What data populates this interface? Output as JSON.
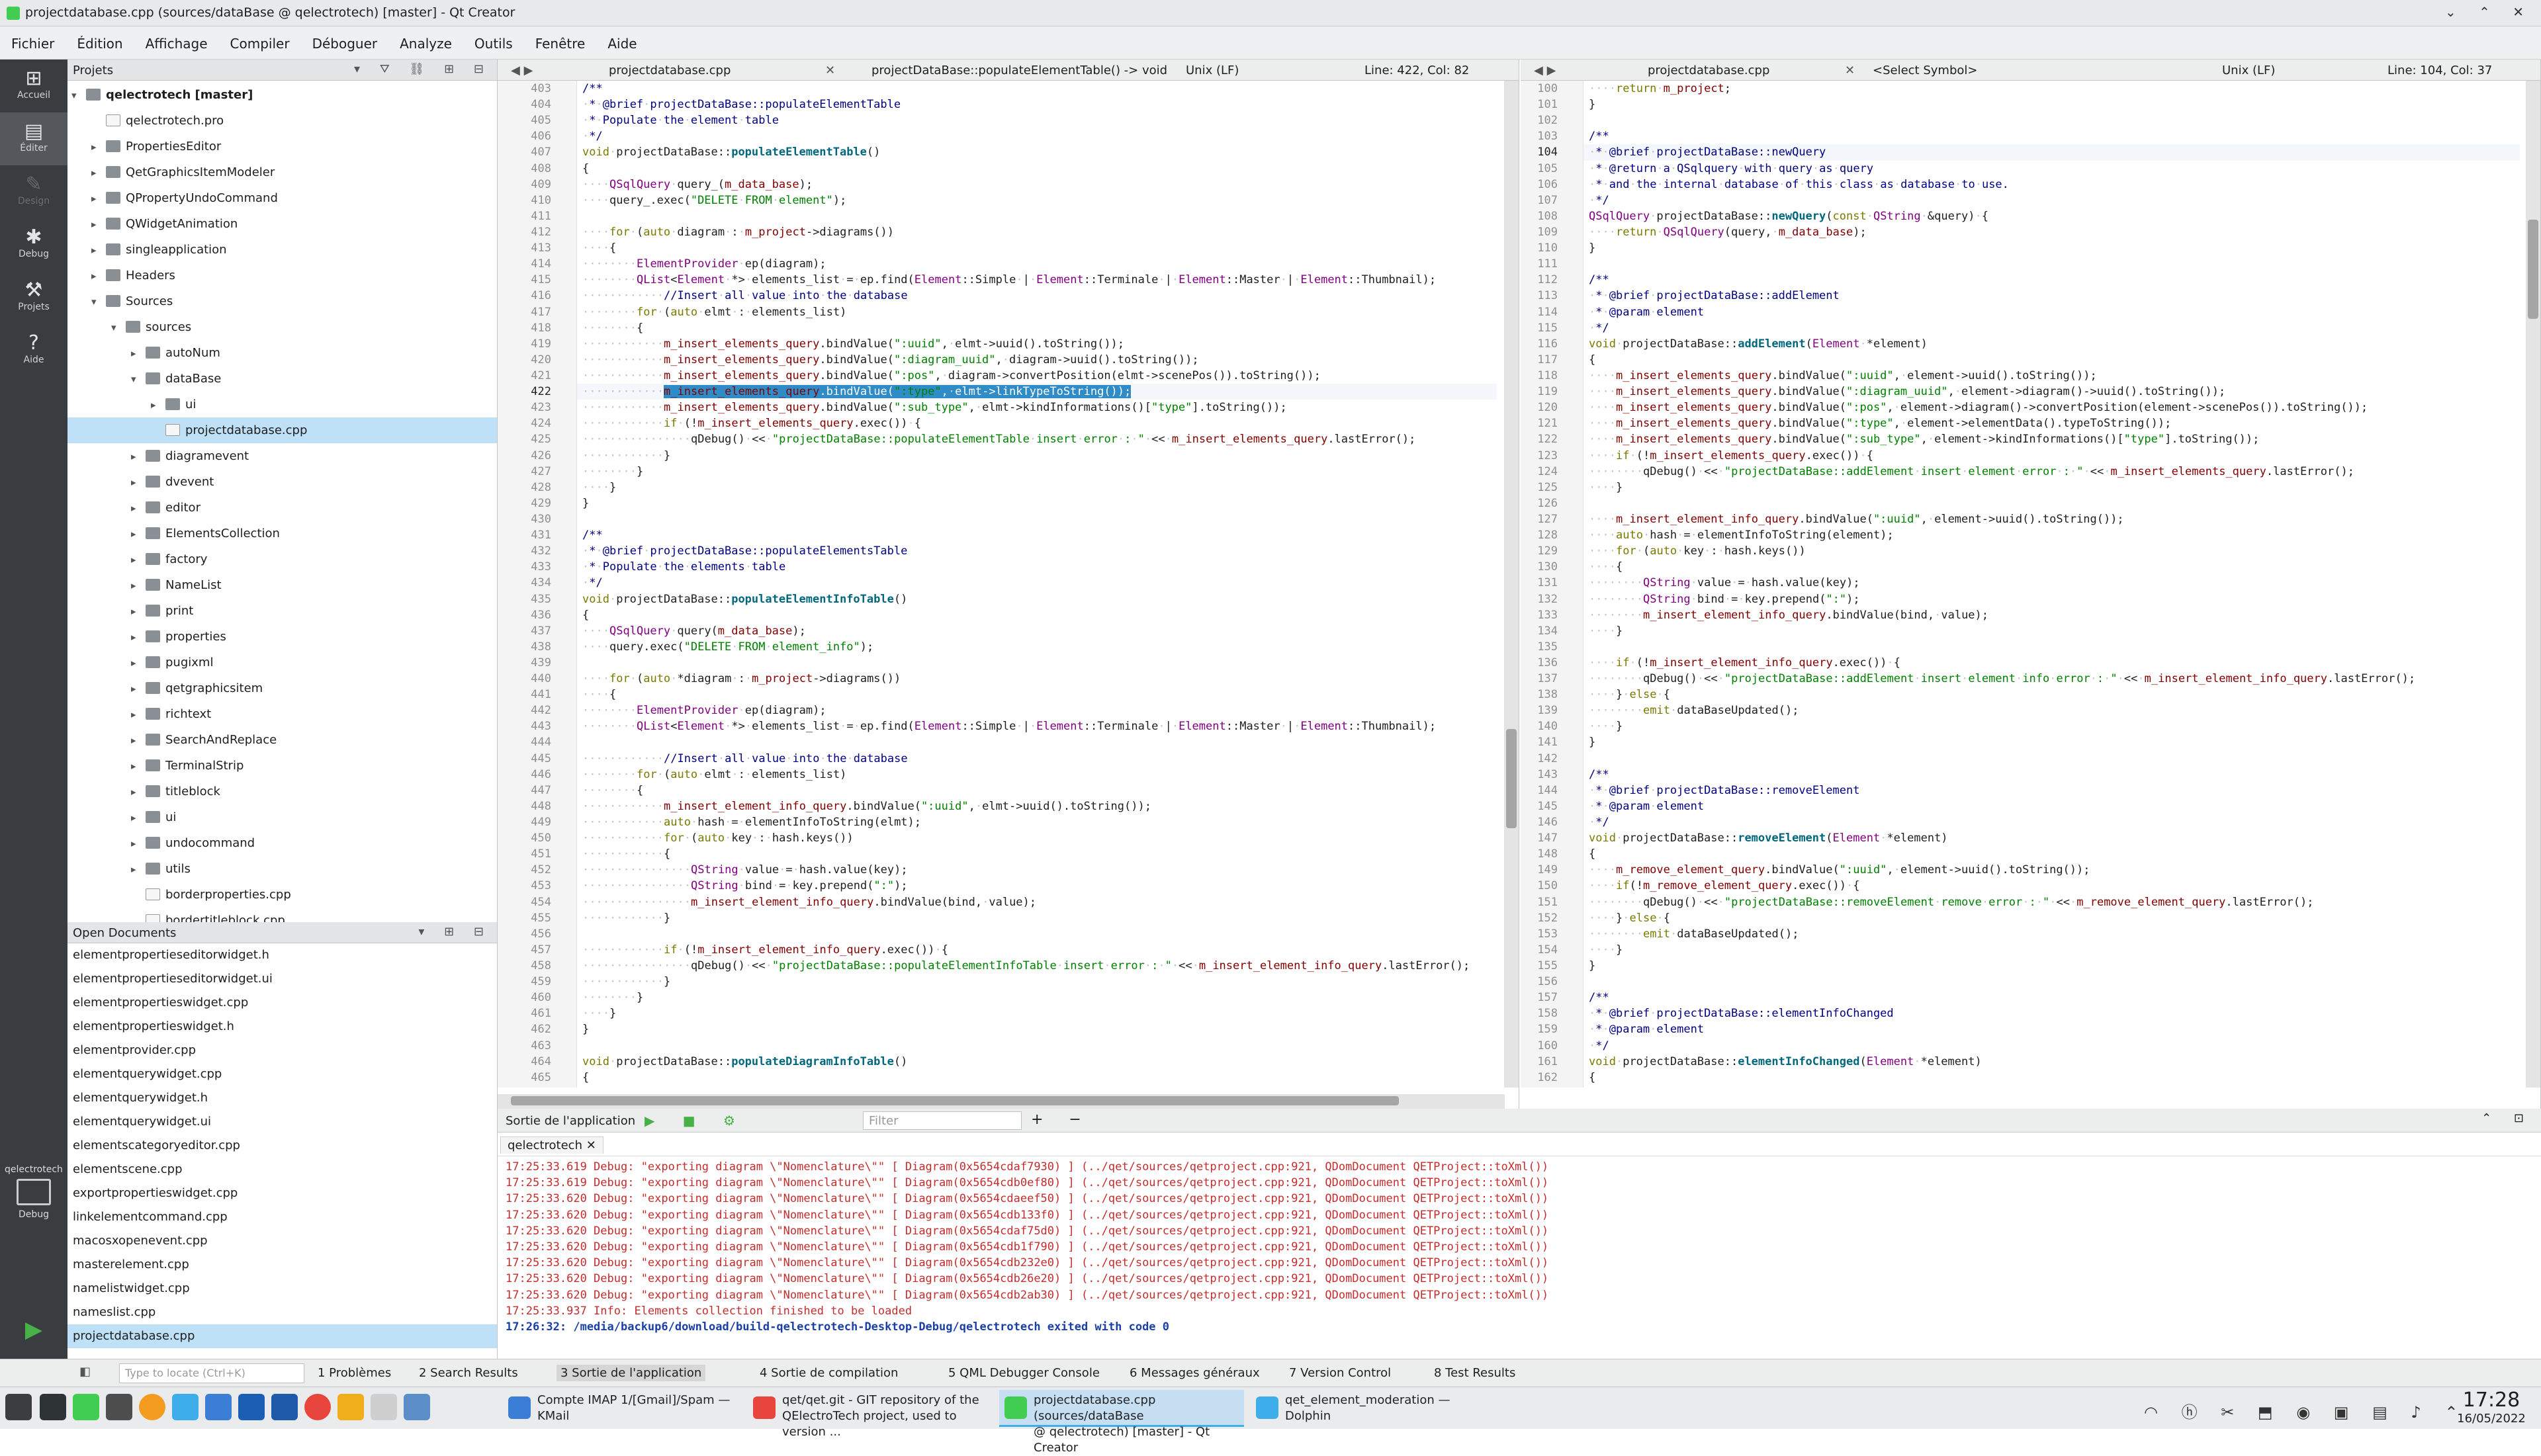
{
  "window": {
    "title": "projectdatabase.cpp (sources/dataBase @ qelectrotech) [master] - Qt Creator",
    "controls": "⌄ ⌃ ✕"
  },
  "menu": [
    "Fichier",
    "Édition",
    "Affichage",
    "Compiler",
    "Déboguer",
    "Analyze",
    "Outils",
    "Fenêtre",
    "Aide"
  ],
  "modes": [
    {
      "label": "Accueil",
      "icon": "grid-icon"
    },
    {
      "label": "Éditer",
      "icon": "edit-icon"
    },
    {
      "label": "Design",
      "icon": "pencil-icon"
    },
    {
      "label": "Debug",
      "icon": "bug-icon"
    },
    {
      "label": "Projets",
      "icon": "wrench-icon"
    },
    {
      "label": "Aide",
      "icon": "help-icon"
    }
  ],
  "kit": {
    "label": "qelectrotech",
    "sub": "Debug"
  },
  "projects_pane": {
    "title": "Projets"
  },
  "tree": [
    {
      "d": 0,
      "t": "qelectrotech [master]",
      "a": "▾",
      "k": "fld",
      "b": true
    },
    {
      "d": 1,
      "t": "qelectrotech.pro",
      "a": "",
      "k": "fle"
    },
    {
      "d": 1,
      "t": "PropertiesEditor",
      "a": "▸",
      "k": "fld"
    },
    {
      "d": 1,
      "t": "QetGraphicsItemModeler",
      "a": "▸",
      "k": "fld"
    },
    {
      "d": 1,
      "t": "QPropertyUndoCommand",
      "a": "▸",
      "k": "fld"
    },
    {
      "d": 1,
      "t": "QWidgetAnimation",
      "a": "▸",
      "k": "fld"
    },
    {
      "d": 1,
      "t": "singleapplication",
      "a": "▸",
      "k": "fld"
    },
    {
      "d": 1,
      "t": "Headers",
      "a": "▸",
      "k": "fld"
    },
    {
      "d": 1,
      "t": "Sources",
      "a": "▾",
      "k": "fld"
    },
    {
      "d": 2,
      "t": "sources",
      "a": "▾",
      "k": "fld"
    },
    {
      "d": 3,
      "t": "autoNum",
      "a": "▸",
      "k": "fld"
    },
    {
      "d": 3,
      "t": "dataBase",
      "a": "▾",
      "k": "fld"
    },
    {
      "d": 4,
      "t": "ui",
      "a": "▸",
      "k": "fld"
    },
    {
      "d": 4,
      "t": "projectdatabase.cpp",
      "a": "",
      "k": "fle",
      "sel": true
    },
    {
      "d": 3,
      "t": "diagramevent",
      "a": "▸",
      "k": "fld"
    },
    {
      "d": 3,
      "t": "dvevent",
      "a": "▸",
      "k": "fld"
    },
    {
      "d": 3,
      "t": "editor",
      "a": "▸",
      "k": "fld"
    },
    {
      "d": 3,
      "t": "ElementsCollection",
      "a": "▸",
      "k": "fld"
    },
    {
      "d": 3,
      "t": "factory",
      "a": "▸",
      "k": "fld"
    },
    {
      "d": 3,
      "t": "NameList",
      "a": "▸",
      "k": "fld"
    },
    {
      "d": 3,
      "t": "print",
      "a": "▸",
      "k": "fld"
    },
    {
      "d": 3,
      "t": "properties",
      "a": "▸",
      "k": "fld"
    },
    {
      "d": 3,
      "t": "pugixml",
      "a": "▸",
      "k": "fld"
    },
    {
      "d": 3,
      "t": "qetgraphicsitem",
      "a": "▸",
      "k": "fld"
    },
    {
      "d": 3,
      "t": "richtext",
      "a": "▸",
      "k": "fld"
    },
    {
      "d": 3,
      "t": "SearchAndReplace",
      "a": "▸",
      "k": "fld"
    },
    {
      "d": 3,
      "t": "TerminalStrip",
      "a": "▸",
      "k": "fld"
    },
    {
      "d": 3,
      "t": "titleblock",
      "a": "▸",
      "k": "fld"
    },
    {
      "d": 3,
      "t": "ui",
      "a": "▸",
      "k": "fld"
    },
    {
      "d": 3,
      "t": "undocommand",
      "a": "▸",
      "k": "fld"
    },
    {
      "d": 3,
      "t": "utils",
      "a": "▸",
      "k": "fld"
    },
    {
      "d": 3,
      "t": "borderproperties.cpp",
      "a": "",
      "k": "fle"
    },
    {
      "d": 3,
      "t": "bordertitleblock.cpp",
      "a": "",
      "k": "fle"
    }
  ],
  "open_documents": {
    "title": "Open Documents",
    "items": [
      "elementpropertieseditorwidget.h",
      "elementpropertieseditorwidget.ui",
      "elementpropertieswidget.cpp",
      "elementpropertieswidget.h",
      "elementprovider.cpp",
      "elementquerywidget.cpp",
      "elementquerywidget.h",
      "elementquerywidget.ui",
      "elementscategoryeditor.cpp",
      "elementscene.cpp",
      "exportpropertieswidget.cpp",
      "linkelementcommand.cpp",
      "macosxopenevent.cpp",
      "masterelement.cpp",
      "namelistwidget.cpp",
      "nameslist.cpp",
      "projectdatabase.cpp"
    ],
    "selected": 16
  },
  "editor_left": {
    "file": "projectdatabase.cpp",
    "symbol": "projectDataBase::populateElementTable() -> void",
    "encoding": "Unix (LF)",
    "position": "Line: 422, Col: 82",
    "first_line": 403,
    "current_line": 422,
    "lines": [
      "/**",
      "·*·@brief·projectDataBase::populateElementTable",
      "·*·Populate·the·element·table",
      "·*/",
      "void·projectDataBase::populateElementTable()",
      "{",
      "····QSqlQuery·query_(m_data_base);",
      "····query_.exec(\"DELETE·FROM·element\");",
      "",
      "····for·(auto·diagram·:·m_project->diagrams())",
      "····{",
      "········ElementProvider·ep(diagram);",
      "········QList<Element·*>·elements_list·=·ep.find(Element::Simple·|·Element::Terminale·|·Element::Master·|·Element::Thumbnail);",
      "············//Insert·all·value·into·the·database",
      "········for·(auto·elmt·:·elements_list)",
      "········{",
      "············m_insert_elements_query.bindValue(\":uuid\",·elmt->uuid().toString());",
      "············m_insert_elements_query.bindValue(\":diagram_uuid\",·diagram->uuid().toString());",
      "············m_insert_elements_query.bindValue(\":pos\",·diagram->convertPosition(elmt->scenePos()).toString());",
      "············m_insert_elements_query.bindValue(\":type\",·elmt->linkTypeToString());",
      "············m_insert_elements_query.bindValue(\":sub_type\",·elmt->kindInformations()[\"type\"].toString());",
      "············if·(!m_insert_elements_query.exec())·{",
      "················qDebug()·<<·\"projectDataBase::populateElementTable·insert·error·:·\"·<<·m_insert_elements_query.lastError();",
      "············}",
      "········}",
      "····}",
      "}",
      "",
      "/**",
      "·*·@brief·projectDataBase::populateElementsTable",
      "·*·Populate·the·elements·table",
      "·*/",
      "void·projectDataBase::populateElementInfoTable()",
      "{",
      "····QSqlQuery·query(m_data_base);",
      "····query.exec(\"DELETE·FROM·element_info\");",
      "",
      "····for·(auto·*diagram·:·m_project->diagrams())",
      "····{",
      "········ElementProvider·ep(diagram);",
      "········QList<Element·*>·elements_list·=·ep.find(Element::Simple·|·Element::Terminale·|·Element::Master·|·Element::Thumbnail);",
      "",
      "············//Insert·all·value·into·the·database",
      "········for·(auto·elmt·:·elements_list)",
      "········{",
      "············m_insert_element_info_query.bindValue(\":uuid\",·elmt->uuid().toString());",
      "············auto·hash·=·elementInfoToString(elmt);",
      "············for·(auto·key·:·hash.keys())",
      "············{",
      "················QString·value·=·hash.value(key);",
      "················QString·bind·=·key.prepend(\":\");",
      "················m_insert_element_info_query.bindValue(bind,·value);",
      "············}",
      "",
      "············if·(!m_insert_element_info_query.exec())·{",
      "················qDebug()·<<·\"projectDataBase::populateElementInfoTable·insert·error·:·\"·<<·m_insert_element_info_query.lastError();",
      "············}",
      "········}",
      "····}",
      "}",
      "",
      "void·projectDataBase::populateDiagramInfoTable()",
      "{"
    ]
  },
  "editor_right": {
    "file": "projectdatabase.cpp",
    "symbol": "<Select Symbol>",
    "encoding": "Unix (LF)",
    "position": "Line: 104, Col: 37",
    "first_line": 100,
    "current_line": 104,
    "lines": [
      "····return·m_project;",
      "}",
      "",
      "/**",
      "·*·@brief·projectDataBase::newQuery",
      "·*·@return·a·QSqlquery·with·query·as·query",
      "·*·and·the·internal·database·of·this·class·as·database·to·use.",
      "·*/",
      "QSqlQuery·projectDataBase::newQuery(const·QString·&query)·{",
      "····return·QSqlQuery(query,·m_data_base);",
      "}",
      "",
      "/**",
      "·*·@brief·projectDataBase::addElement",
      "·*·@param·element",
      "·*/",
      "void·projectDataBase::addElement(Element·*element)",
      "{",
      "····m_insert_elements_query.bindValue(\":uuid\",·element->uuid().toString());",
      "····m_insert_elements_query.bindValue(\":diagram_uuid\",·element->diagram()->uuid().toString());",
      "····m_insert_elements_query.bindValue(\":pos\",·element->diagram()->convertPosition(element->scenePos()).toString());",
      "····m_insert_elements_query.bindValue(\":type\",·element->elementData().typeToString());",
      "····m_insert_elements_query.bindValue(\":sub_type\",·element->kindInformations()[\"type\"].toString());",
      "····if·(!m_insert_elements_query.exec())·{",
      "········qDebug()·<<·\"projectDataBase::addElement·insert·element·error·:·\"·<<·m_insert_elements_query.lastError();",
      "····}",
      "",
      "····m_insert_element_info_query.bindValue(\":uuid\",·element->uuid().toString());",
      "····auto·hash·=·elementInfoToString(element);",
      "····for·(auto·key·:·hash.keys())",
      "····{",
      "········QString·value·=·hash.value(key);",
      "········QString·bind·=·key.prepend(\":\");",
      "········m_insert_element_info_query.bindValue(bind,·value);",
      "····}",
      "",
      "····if·(!m_insert_element_info_query.exec())·{",
      "········qDebug()·<<·\"projectDataBase::addElement·insert·element·info·error·:·\"·<<·m_insert_element_info_query.lastError();",
      "····}·else·{",
      "········emit·dataBaseUpdated();",
      "····}",
      "}",
      "",
      "/**",
      "·*·@brief·projectDataBase::removeElement",
      "·*·@param·element",
      "·*/",
      "void·projectDataBase::removeElement(Element·*element)",
      "{",
      "····m_remove_element_query.bindValue(\":uuid\",·element->uuid().toString());",
      "····if(!m_remove_element_query.exec())·{",
      "········qDebug()·<<·\"projectDataBase::removeElement·remove·error·:·\"·<<·m_remove_element_query.lastError();",
      "····}·else·{",
      "········emit·dataBaseUpdated();",
      "····}",
      "}",
      "",
      "/**",
      "·*·@brief·projectDataBase::elementInfoChanged",
      "·*·@param·element",
      "·*/",
      "void·projectDataBase::elementInfoChanged(Element·*element)",
      "{"
    ]
  },
  "output": {
    "title": "Sortie de l'application",
    "filter_placeholder": "Filter",
    "tab": "qelectrotech",
    "lines": [
      "17:25:33.619 Debug: \"exporting diagram \\\"Nomenclature\\\"\" [ Diagram(0x5654cdaf7930) ] (../qet/sources/qetproject.cpp:921, QDomDocument QETProject::toXml())",
      "17:25:33.619 Debug: \"exporting diagram \\\"Nomenclature\\\"\" [ Diagram(0x5654cdb0ef80) ] (../qet/sources/qetproject.cpp:921, QDomDocument QETProject::toXml())",
      "17:25:33.620 Debug: \"exporting diagram \\\"Nomenclature\\\"\" [ Diagram(0x5654cdaeef50) ] (../qet/sources/qetproject.cpp:921, QDomDocument QETProject::toXml())",
      "17:25:33.620 Debug: \"exporting diagram \\\"Nomenclature\\\"\" [ Diagram(0x5654cdb133f0) ] (../qet/sources/qetproject.cpp:921, QDomDocument QETProject::toXml())",
      "17:25:33.620 Debug: \"exporting diagram \\\"Nomenclature\\\"\" [ Diagram(0x5654cdaf75d0) ] (../qet/sources/qetproject.cpp:921, QDomDocument QETProject::toXml())",
      "17:25:33.620 Debug: \"exporting diagram \\\"Nomenclature\\\"\" [ Diagram(0x5654cdb1f790) ] (../qet/sources/qetproject.cpp:921, QDomDocument QETProject::toXml())",
      "17:25:33.620 Debug: \"exporting diagram \\\"Nomenclature\\\"\" [ Diagram(0x5654cdb232e0) ] (../qet/sources/qetproject.cpp:921, QDomDocument QETProject::toXml())",
      "17:25:33.620 Debug: \"exporting diagram \\\"Nomenclature\\\"\" [ Diagram(0x5654cdb26e20) ] (../qet/sources/qetproject.cpp:921, QDomDocument QETProject::toXml())",
      "17:25:33.620 Debug: \"exporting diagram \\\"Nomenclature\\\"\" [ Diagram(0x5654cdb2ab30) ] (../qet/sources/qetproject.cpp:921, QDomDocument QETProject::toXml())",
      "17:25:33.937 Info: Elements collection finished to be loaded"
    ],
    "exit_line": "17:26:32: /media/backup6/download/build-qelectrotech-Desktop-Debug/qelectrotech exited with code 0"
  },
  "statusbar": {
    "locate_placeholder": "Type to locate (Ctrl+K)",
    "panes": [
      "1 Problèmes",
      "2 Search Results",
      "3 Sortie de l'application",
      "4 Sortie de compilation",
      "5 QML Debugger Console",
      "6 Messages généraux",
      "7 Version Control",
      "8 Test Results"
    ]
  },
  "taskbar": {
    "tasks": [
      {
        "l1": "Compte IMAP 1/[Gmail]/Spam —",
        "l2": "KMail",
        "color": "#3a7fd5"
      },
      {
        "l1": "qet/qet.git - GIT repository of the",
        "l2": "QElectroTech project, used to version ...",
        "color": "#e8453c"
      },
      {
        "l1": "projectdatabase.cpp (sources/dataBase",
        "l2": "@ qelectrotech) [master] - Qt Creator",
        "color": "#41cd52",
        "act": true
      },
      {
        "l1": "qet_element_moderation — Dolphin",
        "l2": "",
        "color": "#3daee9"
      }
    ],
    "time": "17:28",
    "date": "16/05/2022"
  },
  "colors": {
    "selection": "#308cc6",
    "sidebar": "#3a3d40",
    "accent": "#3daee9"
  }
}
